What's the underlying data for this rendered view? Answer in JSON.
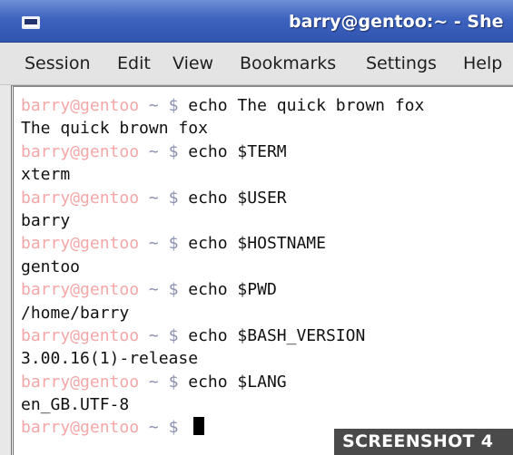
{
  "window": {
    "title": "barry@gentoo:~ - She",
    "icon": "terminal-icon"
  },
  "menu": {
    "items": [
      "Session",
      "Edit",
      "View",
      "Bookmarks",
      "Settings",
      "Help"
    ]
  },
  "terminal": {
    "prompt": {
      "user_host": "barry@gentoo",
      "path": "~ $"
    },
    "lines": [
      {
        "type": "command",
        "text": "echo The quick brown fox"
      },
      {
        "type": "output",
        "text": "The quick brown fox"
      },
      {
        "type": "command",
        "text": "echo $TERM"
      },
      {
        "type": "output",
        "text": "xterm"
      },
      {
        "type": "command",
        "text": "echo $USER"
      },
      {
        "type": "output",
        "text": "barry"
      },
      {
        "type": "command",
        "text": "echo $HOSTNAME"
      },
      {
        "type": "output",
        "text": "gentoo"
      },
      {
        "type": "command",
        "text": "echo $PWD"
      },
      {
        "type": "output",
        "text": "/home/barry"
      },
      {
        "type": "command",
        "text": "echo $BASH_VERSION"
      },
      {
        "type": "output",
        "text": "3.00.16(1)-release"
      },
      {
        "type": "command",
        "text": "echo $LANG"
      },
      {
        "type": "output",
        "text": "en_GB.UTF-8"
      },
      {
        "type": "input",
        "text": ""
      }
    ]
  },
  "overlay": {
    "label": "SCREENSHOT 4"
  },
  "colors": {
    "titlebar": "#3e63bf",
    "prompt_user": "#f5a7a7",
    "prompt_path": "#8a8fb0",
    "terminal_bg": "#ffffff",
    "badge_bg": "#4a4a4a"
  }
}
